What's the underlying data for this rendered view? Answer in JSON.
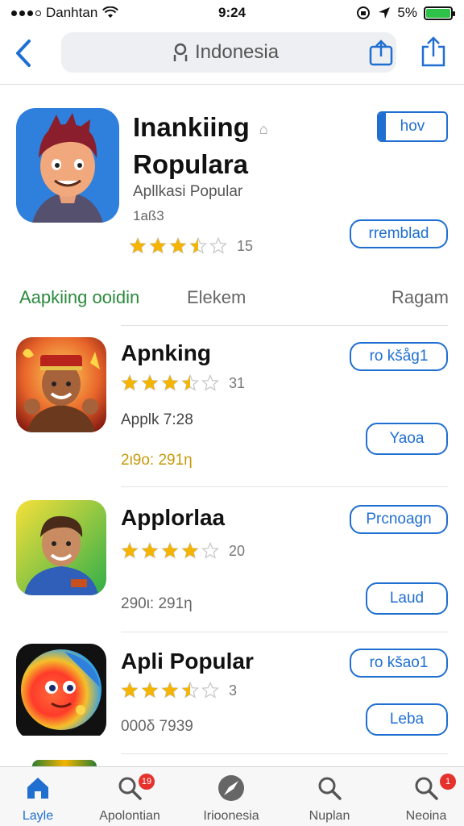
{
  "status_bar": {
    "carrier": "Danhtan",
    "time": "9:24",
    "battery": "5%"
  },
  "search": {
    "query": "Indonesia"
  },
  "featured": {
    "title_line1": "Inankiing",
    "title_line2": "Ropulara",
    "subtitle": "Apllkasi Popular",
    "meta": "1aß3",
    "rating": 3.5,
    "rating_count": "15",
    "primary_button": "hov",
    "secondary_button": "rremblad"
  },
  "tabs": [
    {
      "label": "Aapkiing ooidin",
      "active": true
    },
    {
      "label": "Elekem",
      "active": false
    },
    {
      "label": "Ragam",
      "active": false
    }
  ],
  "apps": [
    {
      "title": "Apnking",
      "rating": 3.5,
      "rating_count": "31",
      "subtitle": "Applk 7:28",
      "meta": "2ι9ο: 291η",
      "button1": "ro kšåg1",
      "button2": "Yaoa"
    },
    {
      "title": "Applorlaa",
      "rating": 4,
      "rating_count": "20",
      "subtitle": "",
      "meta": "290ι: 291η",
      "button1": "Prcnoagn",
      "button2": "Laud"
    },
    {
      "title": "Apli Popular",
      "rating": 3.5,
      "rating_count": "3",
      "subtitle": "",
      "meta": "000δ 7939",
      "button1": "ro kšao1",
      "button2": "Leba"
    }
  ],
  "tabbar": {
    "items": [
      {
        "label": "Layle",
        "icon": "home-icon",
        "active": true
      },
      {
        "label": "Apolontian",
        "icon": "search-icon",
        "badge": "19"
      },
      {
        "label": "Irioonesia",
        "icon": "compass-icon"
      },
      {
        "label": "Nuplan",
        "icon": "search-icon"
      },
      {
        "label": "Neoina",
        "icon": "search-icon",
        "badge": "1"
      }
    ]
  },
  "colors": {
    "accent": "#1f6fd1",
    "tab_active": "#2a8a3c",
    "star": "#f4b400",
    "badge": "#e5322d"
  }
}
